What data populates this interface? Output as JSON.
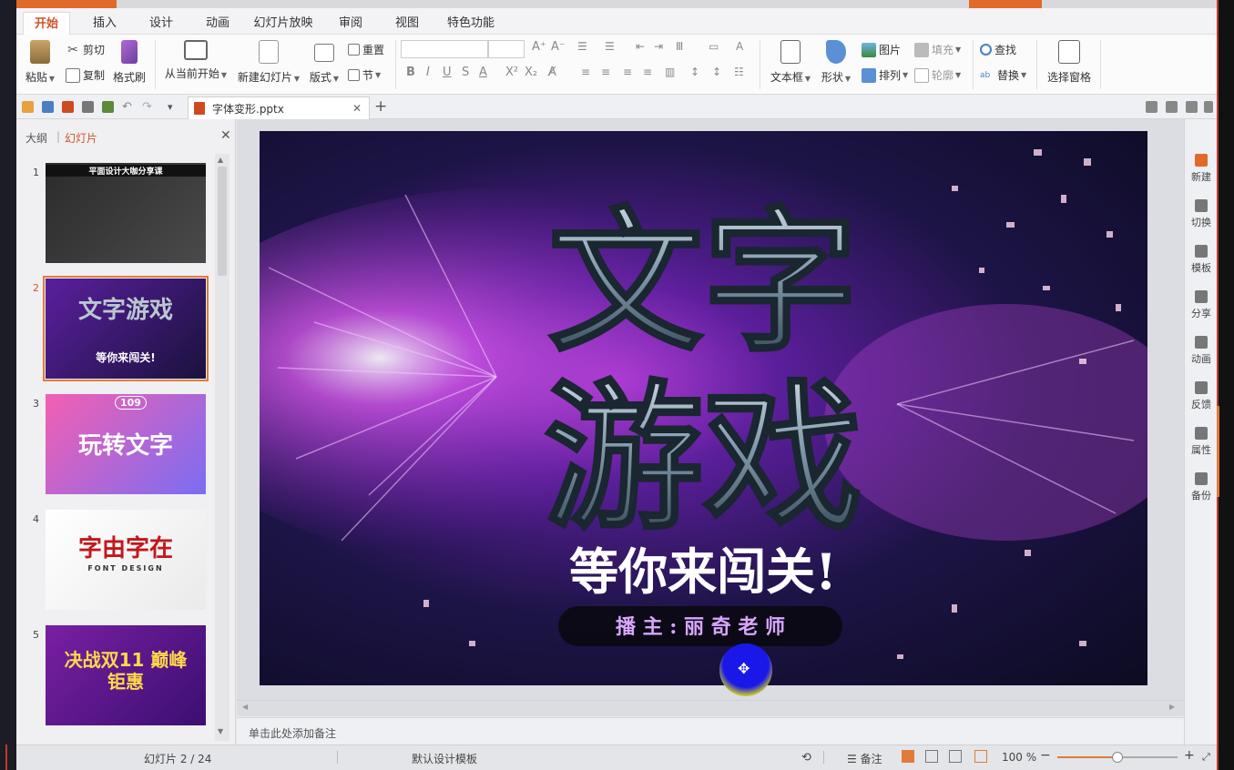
{
  "ribbon_tabs": [
    "开始",
    "插入",
    "设计",
    "动画",
    "幻灯片放映",
    "审阅",
    "视图",
    "特色功能"
  ],
  "ribbon": {
    "paste": "粘贴",
    "cut": "剪切",
    "copy": "复制",
    "format_painter": "格式刷",
    "from_current": "从当前开始",
    "new_slide": "新建幻灯片",
    "layout": "版式",
    "reset": "重置",
    "section": "节",
    "textbox": "文本框",
    "shape": "形状",
    "picture": "图片",
    "fill": "填充",
    "arrange": "排列",
    "outline": "轮廓",
    "find": "查找",
    "replace": "替换",
    "selection_pane": "选择窗格"
  },
  "document_tab": {
    "filename": "字体变形.pptx"
  },
  "left_panel": {
    "tab_outline": "大纲",
    "tab_slides": "幻灯片",
    "thumbnails": [
      {
        "num": "1",
        "title": "平面设计大咖分享课",
        "colors": [
          "#2b2b2b",
          "#4a4a4a"
        ]
      },
      {
        "num": "2",
        "title": "文字游戏",
        "subtitle": "等你来闯关!",
        "colors": [
          "#5b1f9e",
          "#19123d"
        ]
      },
      {
        "num": "3",
        "title": "玩转文字",
        "badge": "109",
        "colors": [
          "#f45fb2",
          "#7b6df2"
        ]
      },
      {
        "num": "4",
        "title": "字由字在",
        "subtitle": "FONT DESIGN",
        "colors": [
          "#ffffff",
          "#eaeaea"
        ]
      },
      {
        "num": "5",
        "title": "决战双11 巅峰钜惠",
        "colors": [
          "#7a1fa2",
          "#3a0f72"
        ]
      }
    ]
  },
  "slide": {
    "line1": "文字",
    "line2": "游戏",
    "subtitle": "等你来闯关!",
    "host": "播 主 : 丽 奇 老 师"
  },
  "notes_placeholder": "单击此处添加备注",
  "right_sidebar": [
    "新建",
    "切换",
    "模板",
    "分享",
    "动画",
    "反馈",
    "属性",
    "备份"
  ],
  "status": {
    "slide_counter": "幻灯片 2 / 24",
    "template": "默认设计模板",
    "notes": "备注",
    "zoom": "100 %",
    "zoom_fraction": 0.5
  },
  "colors": {
    "accent": "#d0542a",
    "brand": "#e06a2a"
  }
}
